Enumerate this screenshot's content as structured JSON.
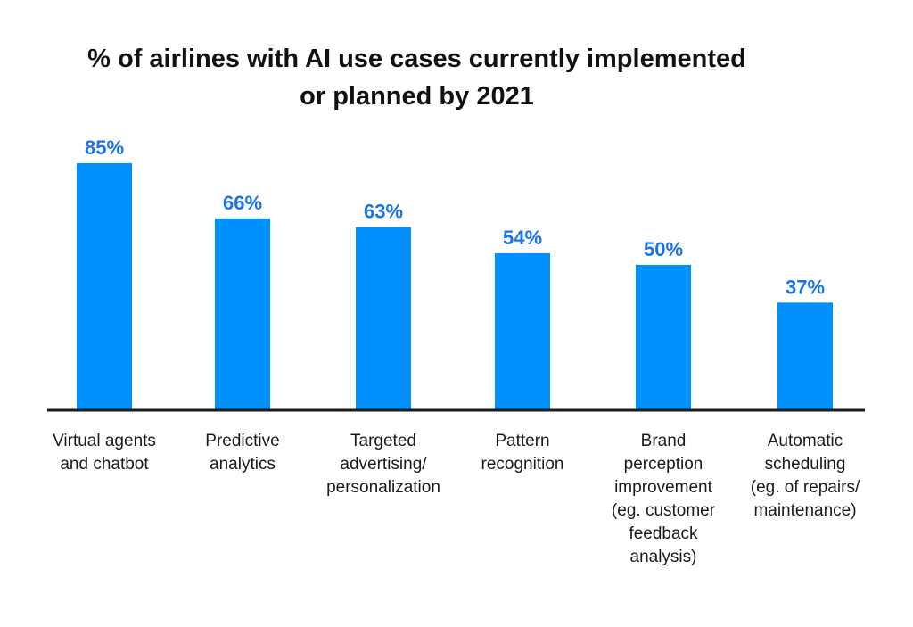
{
  "title_line1": "% of airlines with AI use cases currently implemented",
  "title_line2": "or planned by 2021",
  "colors": {
    "bar": "#0091FF",
    "label": "#1A73E8",
    "axis": "#1a1a1a"
  },
  "chart_data": {
    "type": "bar",
    "title": "% of airlines with AI use cases currently implemented or planned by 2021",
    "xlabel": "",
    "ylabel": "",
    "ylim": [
      0,
      100
    ],
    "grid": false,
    "legend": "none",
    "categories": [
      "Virtual agents and chatbot",
      "Predictive analytics",
      "Targeted advertising/ personalization",
      "Pattern recognition",
      "Brand perception improvement (eg. customer feedback analysis)",
      "Automatic scheduling (eg. of repairs/ maintenance)"
    ],
    "category_lines": [
      [
        "Virtual agents",
        "and chatbot"
      ],
      [
        "Predictive",
        "analytics"
      ],
      [
        "Targeted",
        "advertising/",
        "personalization"
      ],
      [
        "Pattern",
        "recognition"
      ],
      [
        "Brand",
        "perception",
        "improvement",
        "(eg. customer",
        "feedback",
        "analysis)"
      ],
      [
        "Automatic",
        "scheduling",
        "(eg. of repairs/",
        "maintenance)"
      ]
    ],
    "values": [
      85,
      66,
      63,
      54,
      50,
      37
    ],
    "value_labels": [
      "85%",
      "66%",
      "63%",
      "54%",
      "50%",
      "37%"
    ]
  }
}
